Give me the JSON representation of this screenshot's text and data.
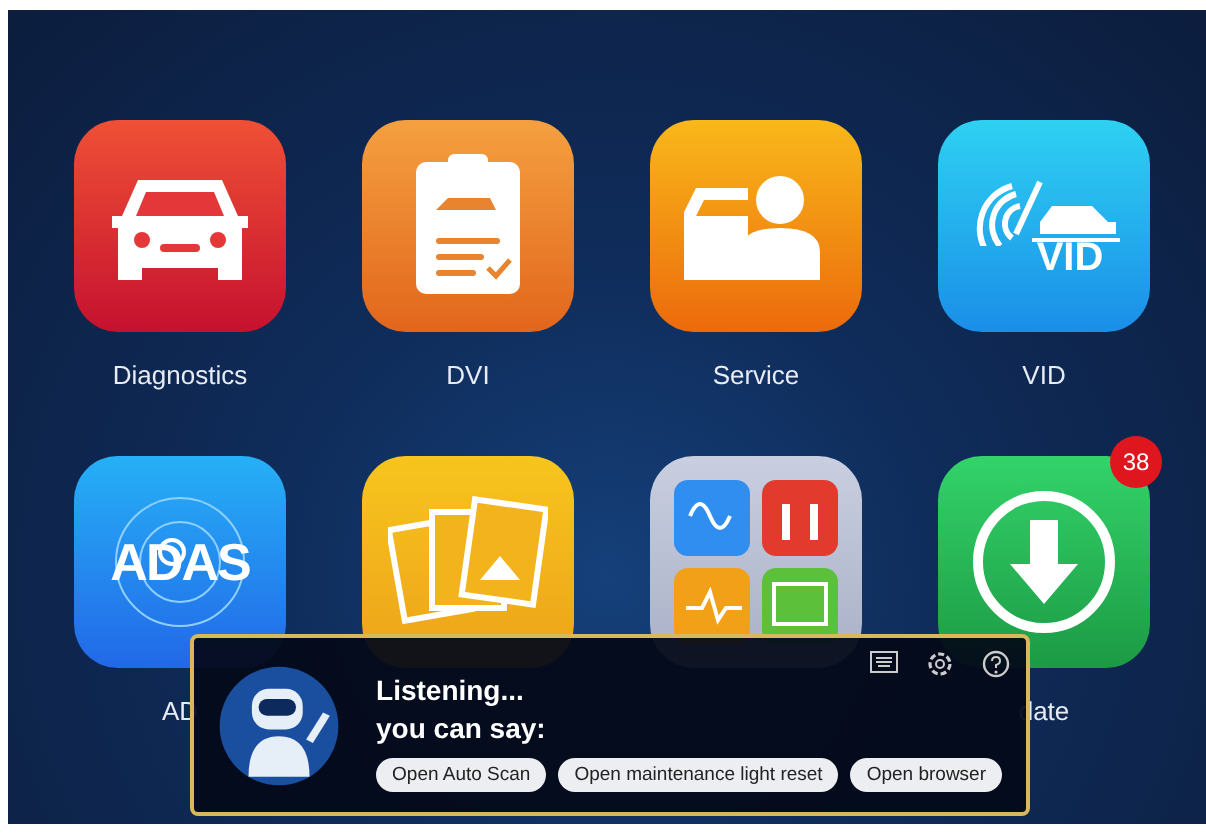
{
  "apps": [
    {
      "kind": "diagnostics",
      "label": "Diagnostics"
    },
    {
      "kind": "dvi",
      "label": "DVI"
    },
    {
      "kind": "service",
      "label": "Service"
    },
    {
      "kind": "vid",
      "label": "VID",
      "tile_text": "VID"
    },
    {
      "kind": "adas",
      "label": "AD",
      "tile_text": "ADAS"
    },
    {
      "kind": "gallery"
    },
    {
      "kind": "measurement"
    },
    {
      "kind": "update",
      "label": "date",
      "badge": "38"
    }
  ],
  "voice_panel": {
    "status": "Listening...",
    "prompt": "you can say:",
    "suggestions": [
      "Open Auto Scan",
      "Open maintenance light reset",
      "Open browser"
    ]
  }
}
